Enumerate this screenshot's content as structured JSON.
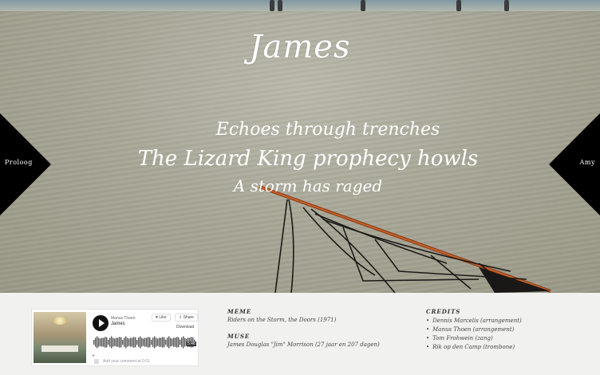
{
  "hero": {
    "title": "James",
    "poem": [
      "Echoes through trenches",
      "The Lizard King prophecy howls",
      "A storm has raged"
    ]
  },
  "nav": {
    "prev_label": "Proloog",
    "next_label": "Amy"
  },
  "player": {
    "artist": "Manus Thoen",
    "track": "James",
    "like_label": "Like",
    "share_label": "Share",
    "download_label": "Download",
    "duration": "5:48",
    "comment_placeholder": "Add your comment at 0:01",
    "plus": "+"
  },
  "meme": {
    "heading": "MEME",
    "text": "Riders on the Storm, the Doors (1971)"
  },
  "muse": {
    "heading": "MUSE",
    "text": "James Douglas \"Jim\" Morrison (27 jaar en 207 dagen)"
  },
  "credits": {
    "heading": "CREDITS",
    "items": [
      "Dennis Marcelis (arrangement)",
      "Manus Thoen (arrangement)",
      "Tom Frohwein (zang)",
      "Rik op den Camp (trombone)"
    ]
  },
  "colors": {
    "nav_background": "#000000",
    "text_white": "#ffffff"
  }
}
